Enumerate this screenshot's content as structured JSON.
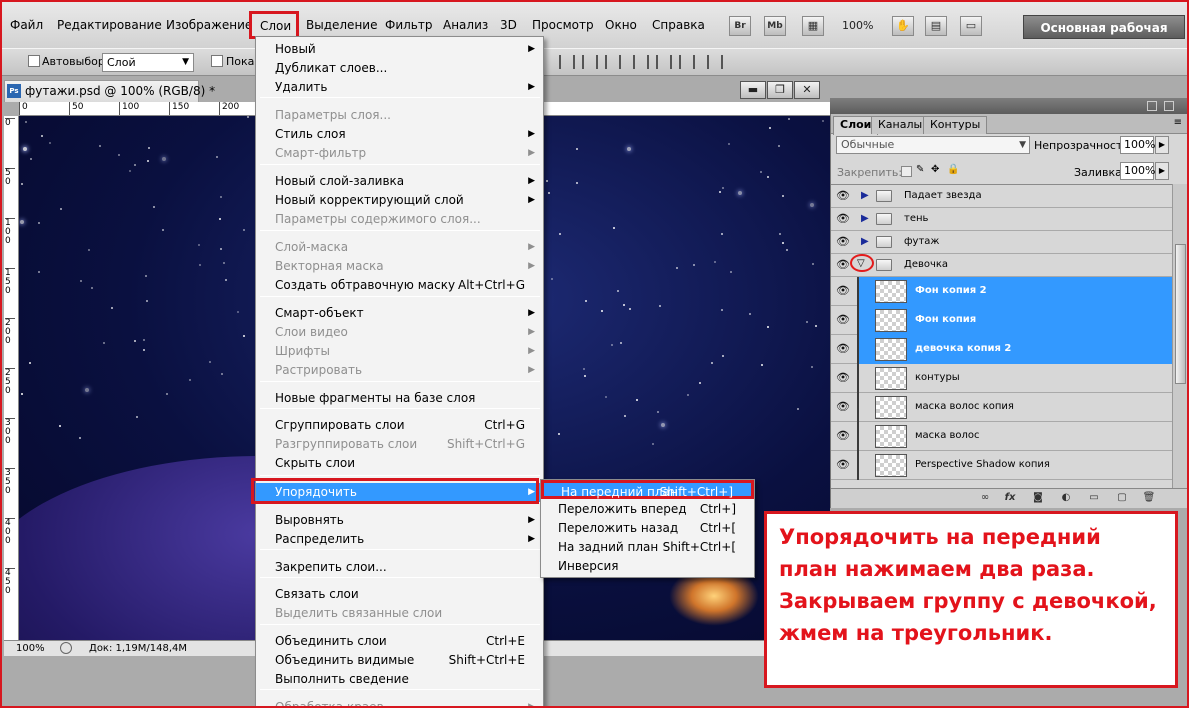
{
  "menubar": {
    "items": [
      "Файл",
      "Редактирование",
      "Изображение",
      "Слои",
      "Выделение",
      "Фильтр",
      "Анализ",
      "3D",
      "Просмотр",
      "Окно",
      "Справка"
    ],
    "bridge_btn": "Br",
    "minibridge_btn": "Mb",
    "zoom": "100%",
    "workspace": "Основная рабочая среда"
  },
  "options": {
    "autoselect_label": "Автовыбор:",
    "autoselect_value": "Слой",
    "show_label": "Показ"
  },
  "document": {
    "tab_title": "футажи.psd @ 100% (RGB/8) *",
    "ps_badge": "Ps",
    "ruler_h": [
      "0",
      "50",
      "100",
      "150",
      "200"
    ],
    "ruler_v": [
      "0",
      "50",
      "100",
      "150",
      "200",
      "250",
      "300",
      "350",
      "400",
      "450"
    ],
    "status_zoom": "100%",
    "status_doc": "Док: 1,19M/148,4M",
    "win_minimize": "▬",
    "win_restore": "❐",
    "win_close": "✕"
  },
  "layer_menu": {
    "items": [
      {
        "label": "Новый",
        "submenu": true
      },
      {
        "label": "Дубликат слоев..."
      },
      {
        "label": "Удалить",
        "submenu": true
      },
      {
        "label": "Параметры слоя...",
        "disabled": true
      },
      {
        "label": "Стиль слоя",
        "submenu": true
      },
      {
        "label": "Смарт-фильтр",
        "disabled": true,
        "submenu": true
      },
      {
        "label": "Новый слой-заливка",
        "submenu": true
      },
      {
        "label": "Новый корректирующий слой",
        "submenu": true
      },
      {
        "label": "Параметры содержимого слоя...",
        "disabled": true
      },
      {
        "label": "Слой-маска",
        "disabled": true,
        "submenu": true
      },
      {
        "label": "Векторная маска",
        "disabled": true,
        "submenu": true
      },
      {
        "label": "Создать обтравочную маску",
        "shortcut": "Alt+Ctrl+G"
      },
      {
        "label": "Смарт-объект",
        "submenu": true
      },
      {
        "label": "Слои видео",
        "disabled": true,
        "submenu": true
      },
      {
        "label": "Шрифты",
        "disabled": true,
        "submenu": true
      },
      {
        "label": "Растрировать",
        "disabled": true,
        "submenu": true
      },
      {
        "label": "Новые фрагменты на базе слоя"
      },
      {
        "label": "Сгруппировать слои",
        "shortcut": "Ctrl+G"
      },
      {
        "label": "Разгруппировать слои",
        "shortcut": "Shift+Ctrl+G",
        "disabled": true
      },
      {
        "label": "Скрыть слои"
      },
      {
        "label": "Упорядочить",
        "submenu": true,
        "highlighted": true
      },
      {
        "label": "Выровнять",
        "submenu": true
      },
      {
        "label": "Распределить",
        "submenu": true
      },
      {
        "label": "Закрепить слои..."
      },
      {
        "label": "Связать слои"
      },
      {
        "label": "Выделить связанные слои",
        "disabled": true
      },
      {
        "label": "Объединить слои",
        "shortcut": "Ctrl+E"
      },
      {
        "label": "Объединить видимые",
        "shortcut": "Shift+Ctrl+E"
      },
      {
        "label": "Выполнить сведение"
      },
      {
        "label": "Обработка краев",
        "disabled": true,
        "submenu": true
      }
    ],
    "submenu_arrow": "▶"
  },
  "arrange_submenu": {
    "items": [
      {
        "label": "На передний план",
        "shortcut": "Shift+Ctrl+]",
        "highlighted": true
      },
      {
        "label": "Переложить вперед",
        "shortcut": "Ctrl+]"
      },
      {
        "label": "Переложить назад",
        "shortcut": "Ctrl+["
      },
      {
        "label": "На задний план",
        "shortcut": "Shift+Ctrl+["
      },
      {
        "label": "Инверсия"
      }
    ]
  },
  "layers_panel": {
    "tabs": [
      "Слои",
      "Каналы",
      "Контуры"
    ],
    "active_tab": "Слои",
    "blend_mode": "Обычные",
    "opacity_label": "Непрозрачность:",
    "opacity_value": "100%",
    "lock_label": "Закрепить:",
    "fill_label": "Заливка:",
    "fill_value": "100%",
    "layers": [
      {
        "name": "Падает звезда",
        "type": "group",
        "expanded": false
      },
      {
        "name": "тень",
        "type": "group",
        "expanded": false
      },
      {
        "name": "футаж",
        "type": "group",
        "expanded": false
      },
      {
        "name": "Девочка",
        "type": "group",
        "expanded": true
      },
      {
        "name": "Фон копия 2",
        "type": "layer",
        "selected": true
      },
      {
        "name": "Фон копия",
        "type": "layer",
        "selected": true
      },
      {
        "name": "девочка копия 2",
        "type": "layer",
        "selected": true
      },
      {
        "name": "контуры",
        "type": "layer"
      },
      {
        "name": "маска волос копия",
        "type": "layer"
      },
      {
        "name": "маска волос",
        "type": "layer"
      },
      {
        "name": "Perspective Shadow копия",
        "type": "layer"
      }
    ],
    "footer_icons": [
      "link-icon",
      "fx-icon",
      "mask-icon",
      "adjustment-icon",
      "group-icon",
      "new-layer-icon",
      "trash-icon"
    ],
    "fx_glyph": "fx"
  },
  "annotation": {
    "lines": [
      "Упорядочить на передний",
      "план нажимаем два раза.",
      "Закрываем группу с девочкой,",
      "жмем на треугольник."
    ]
  },
  "colors": {
    "highlight": "#3399ff",
    "annotation_red": "#e3131b",
    "frame_red": "#d7171f"
  }
}
